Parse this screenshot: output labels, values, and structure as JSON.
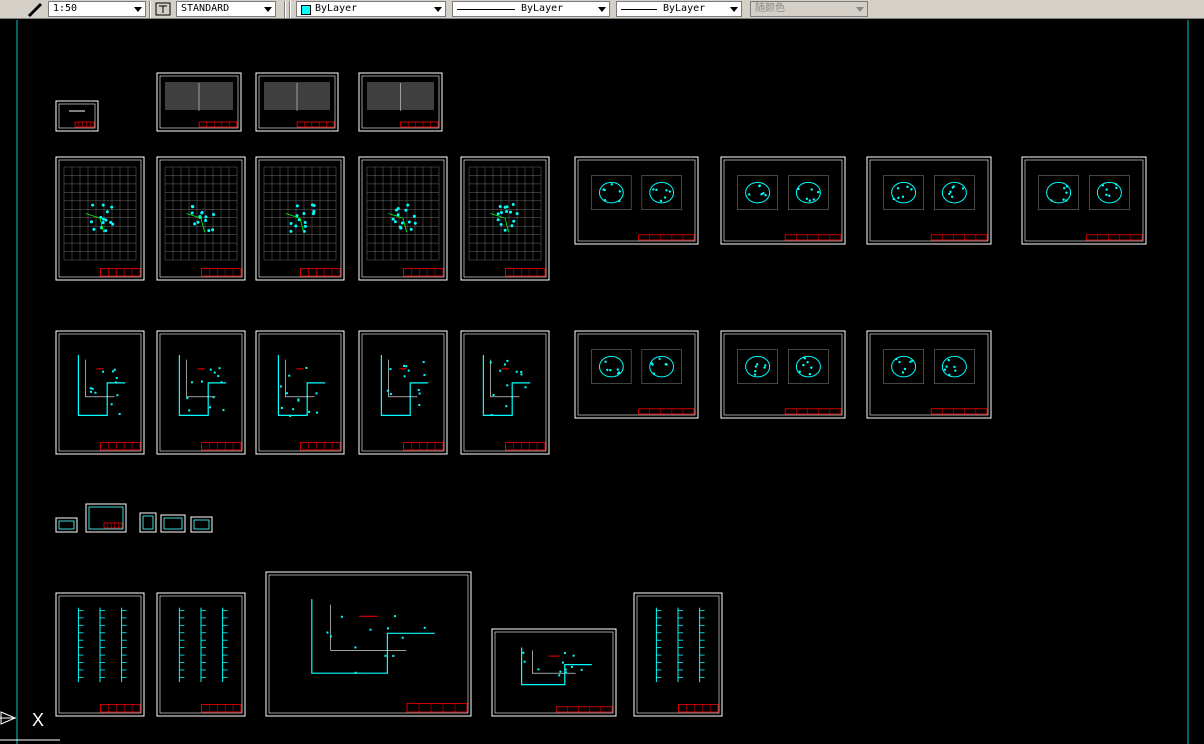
{
  "toolbar": {
    "scale": {
      "value": "1:50"
    },
    "text_style": {
      "value": "STANDARD"
    },
    "layer": {
      "value": "ByLayer",
      "swatch_color": "#00ffff"
    },
    "linetype": {
      "value": "ByLayer"
    },
    "lineweight": {
      "value": "ByLayer"
    },
    "plot_style": {
      "value": "随颜色"
    }
  },
  "canvas": {
    "background": "#000000",
    "sheet_border_color": "#ffffff",
    "title_block_color": "#ff0000",
    "accent_color": "#00ffff",
    "ucs_icon": "ucs-axis-icon",
    "ucs_label": "X"
  }
}
